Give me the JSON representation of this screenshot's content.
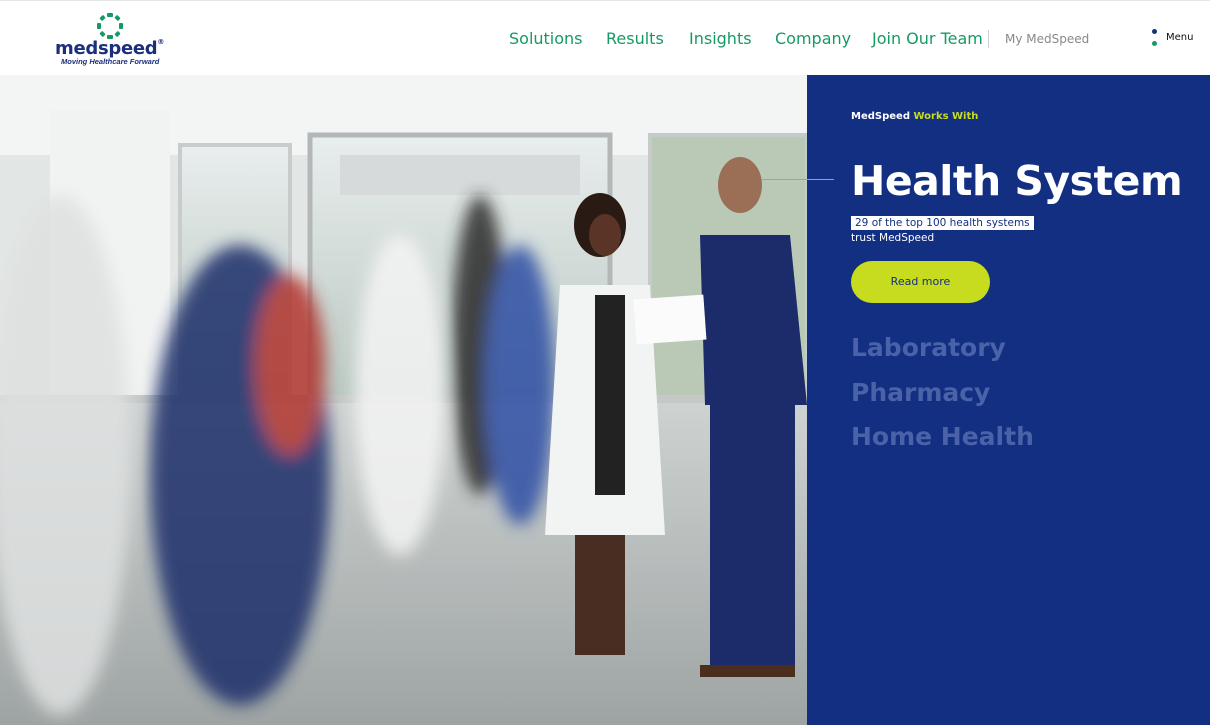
{
  "brand": {
    "name": "medspeed",
    "registered": "®",
    "tagline": "Moving Healthcare Forward",
    "colors": {
      "green": "#169a63",
      "navy": "#1b2f7d",
      "panel": "#132f82",
      "lime": "#c7dc1e"
    }
  },
  "nav": {
    "items": [
      {
        "label": "Solutions"
      },
      {
        "label": "Results"
      },
      {
        "label": "Insights"
      },
      {
        "label": "Company"
      },
      {
        "label": "Join Our Team"
      }
    ],
    "account_link": "My MedSpeed",
    "menu_label": "Menu",
    "menu_dot_colors": [
      "#1b2f7d",
      "#169a63"
    ]
  },
  "hero": {
    "image": "photo of doctor and nurse reviewing a document in a busy hospital lobby"
  },
  "panel": {
    "works_with_prefix": "MedSpeed",
    "works_with_highlight": "Works With",
    "active_item": "Health System",
    "stat_badge": "29 of the top 100 health systems",
    "stat_text": "trust MedSpeed",
    "cta_label": "Read more",
    "other_items": [
      "Laboratory",
      "Pharmacy",
      "Home Health"
    ]
  }
}
